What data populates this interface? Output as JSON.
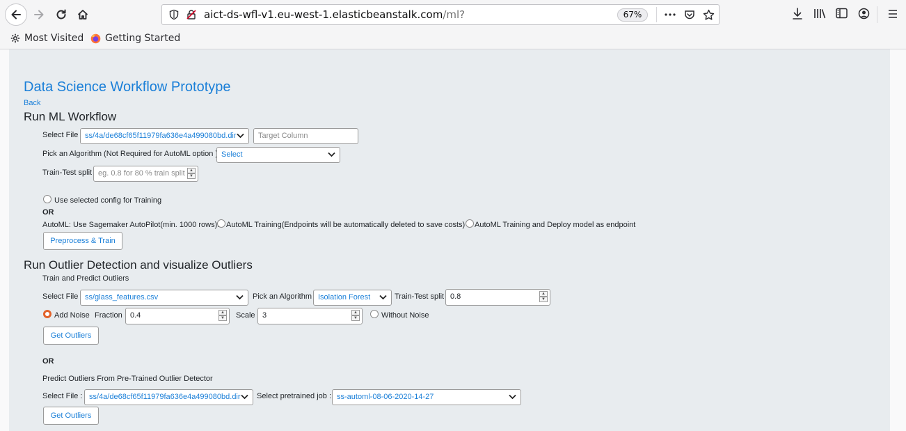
{
  "browser": {
    "url_host": "aict-ds-wfl-v1.eu-west-1.elasticbeanstalk.com",
    "url_path": "/ml?",
    "zoom": "67%",
    "bookmarks": [
      "Most Visited",
      "Getting Started"
    ]
  },
  "page": {
    "title": "Data Science Workflow Prototype",
    "back_link": "Back",
    "section1": {
      "heading": "Run ML Workflow",
      "select_file_label": "Select File",
      "select_file_value": "ss/4a/de68cf65f11979fa636e4a499080bd.dir",
      "target_column_placeholder": "Target Column",
      "algorithm_label": "Pick an Algorithm (Not Required for AutoML option )",
      "algorithm_value": "Select",
      "split_label": "Train-Test split",
      "split_placeholder": "eg. 0.8 for 80 % train split",
      "use_config_label": "Use selected config for Training",
      "or_label": "OR",
      "automl_label": "AutoML: Use Sagemaker AutoPilot(min. 1000 rows):",
      "automl_option1": "AutoML Training(Endpoints will be automatically deleted to save costs)",
      "automl_option2": "AutoML Training and Deploy model as endpoint",
      "train_button": "Preprocess & Train"
    },
    "section2": {
      "heading": "Run Outlier Detection and visualize Outliers",
      "subheading": "Train and Predict Outliers",
      "select_file_label": "Select File",
      "select_file_value": "ss/glass_features.csv",
      "algorithm_label": "Pick an Algorithm",
      "algorithm_value": "Isolation Forest",
      "split_label": "Train-Test split",
      "split_value": "0.8",
      "add_noise_label": "Add Noise",
      "fraction_label": "Fraction",
      "fraction_value": "0.4",
      "scale_label": "Scale",
      "scale_value": "3",
      "without_noise_label": "Without Noise",
      "get_outliers_button": "Get Outliers",
      "or_label": "OR",
      "pretrained_heading": "Predict Outliers From Pre-Trained Outlier Detector",
      "select_file2_label": "Select File :",
      "select_file2_value": "ss/4a/de68cf65f11979fa636e4a499080bd.dir",
      "pretrained_job_label": "Select pretrained job :",
      "pretrained_job_value": "ss-automl-08-06-2020-14-27",
      "get_outliers_button2": "Get Outliers"
    }
  }
}
